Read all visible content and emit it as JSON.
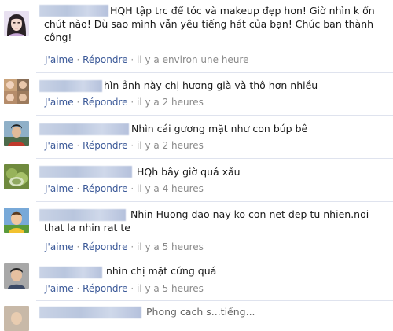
{
  "comments": [
    {
      "lines": [
        "HQH tập trc để tóc và makeup đẹp hơn! Giờ nhìn k ổn",
        "chút nào! Dù sao mình vẫn yêu tiếng hát của bạn! Chúc bạn thành",
        "công!"
      ],
      "like": "J'aime",
      "reply": "Répondre",
      "time": "il y a environ une heure",
      "avatar": "avatar-girl-icon"
    },
    {
      "lines": [
        "hìn ảnh này chị hương già và thô hơn nhiều"
      ],
      "like": "J'aime",
      "reply": "Répondre",
      "time": "il y a 2 heures",
      "avatar": "avatar-photo-icon"
    },
    {
      "lines": [
        "Nhìn cái gương mặt như con búp bê"
      ],
      "like": "J'aime",
      "reply": "Répondre",
      "time": "il y a 2 heures",
      "avatar": "avatar-man-icon"
    },
    {
      "lines": [
        "HQh bây giờ quá xấu"
      ],
      "like": "J'aime",
      "reply": "Répondre",
      "time": "il y a 4 heures",
      "avatar": "avatar-plant-icon"
    },
    {
      "lines": [
        "Nhin Huong dao nay ko con net dep tu nhien.noi",
        "that la nhin rat te"
      ],
      "like": "J'aime",
      "reply": "Répondre",
      "time": "il y a 5 heures",
      "avatar": "avatar-kid-icon"
    },
    {
      "lines": [
        "nhìn chị mặt cứng quá"
      ],
      "like": "J'aime",
      "reply": "Répondre",
      "time": "il y a 5 heures",
      "avatar": "avatar-boy-icon"
    },
    {
      "lines": [
        "Phong cach s...tiếng..."
      ],
      "like": "",
      "reply": "",
      "time": "",
      "avatar": "avatar-partial-icon"
    }
  ],
  "colors": {
    "link": "#3b5998",
    "text": "#1a1a1a",
    "meta": "#8a8a8a",
    "divider": "#dfe3ee"
  }
}
